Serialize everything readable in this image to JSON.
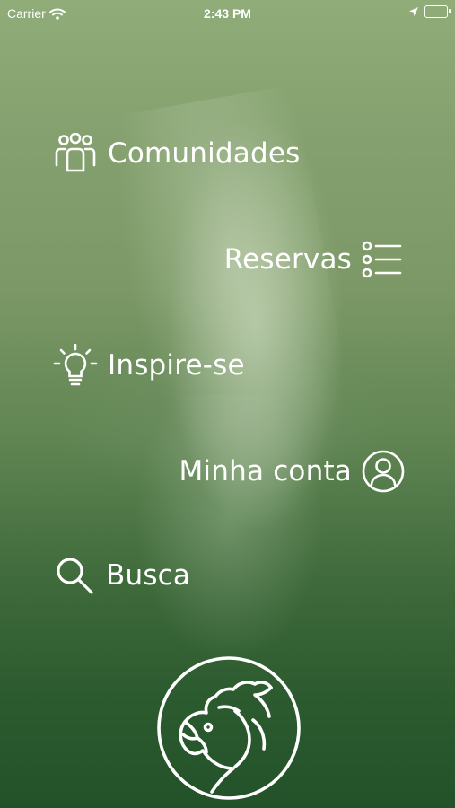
{
  "status_bar": {
    "carrier": "Carrier",
    "time": "2:43 PM"
  },
  "menu": {
    "items": [
      {
        "label": "Comunidades",
        "icon": "people-icon"
      },
      {
        "label": "Reservas",
        "icon": "list-icon"
      },
      {
        "label": "Inspire-se",
        "icon": "lightbulb-icon"
      },
      {
        "label": "Minha conta",
        "icon": "user-circle-icon"
      },
      {
        "label": "Busca",
        "icon": "search-icon"
      }
    ]
  },
  "colors": {
    "text": "#ffffff",
    "background_top": "#90ac78",
    "background_bottom": "#23522a"
  }
}
